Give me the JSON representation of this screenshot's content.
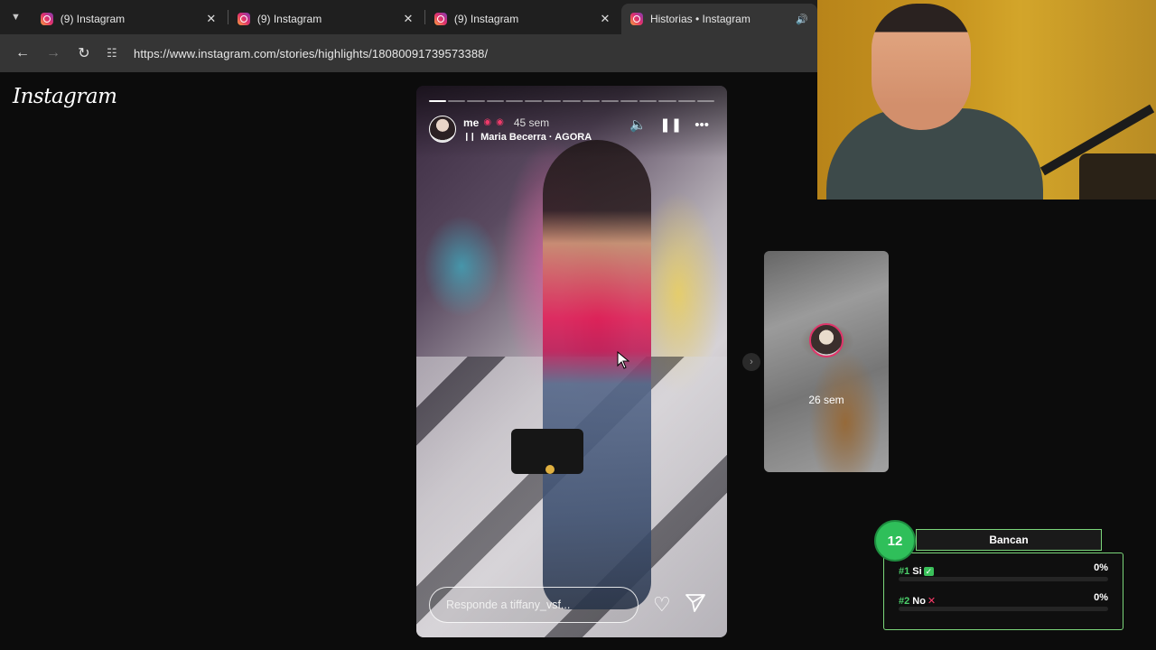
{
  "browser": {
    "tabs": [
      {
        "title": "(9) Instagram",
        "active": false
      },
      {
        "title": "(9) Instagram",
        "active": false
      },
      {
        "title": "(9) Instagram",
        "active": false
      },
      {
        "title": "Historias • Instagram",
        "active": true
      }
    ],
    "url": "https://www.instagram.com/stories/highlights/18080091739573388/"
  },
  "instagram": {
    "logo_text": "Instagram"
  },
  "story": {
    "username": "me",
    "time_ago": "45 sem",
    "music": "Maria Becerra · AGORA",
    "reply_placeholder": "Responde a tiffany_vsf...",
    "progress_segments": 15,
    "progress_done": 1
  },
  "next_story": {
    "time_ago": "26 sem"
  },
  "poll": {
    "badge": "12",
    "title": "Bancan",
    "options": [
      {
        "rank": "#1",
        "label": "Si",
        "mark": "✓",
        "percent": "0%"
      },
      {
        "rank": "#2",
        "label": "No",
        "mark": "✕",
        "percent": "0%"
      }
    ]
  },
  "colors": {
    "poll_accent": "#4bd06b",
    "lips": "#f03b6a"
  }
}
